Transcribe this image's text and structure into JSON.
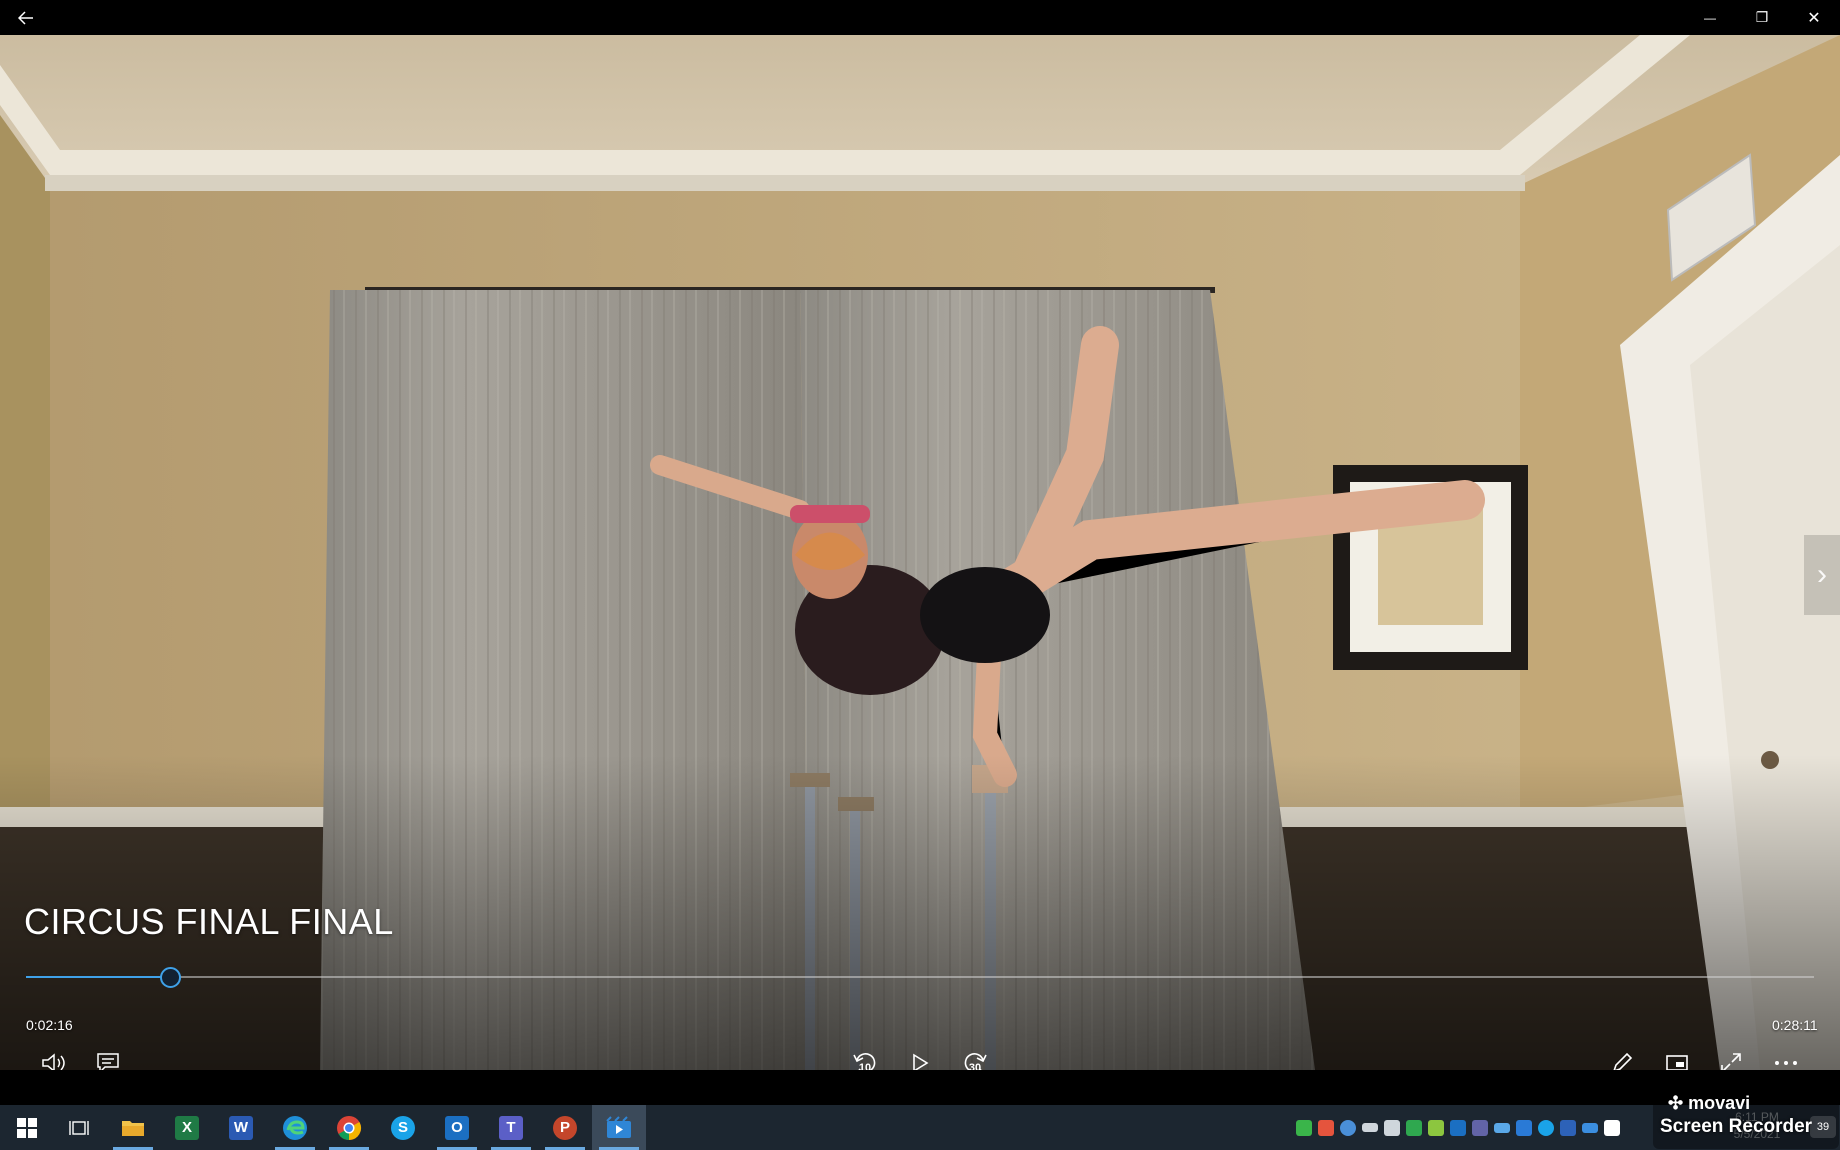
{
  "titlebar": {
    "back_icon": "back-arrow-icon",
    "minimize_glyph": "—",
    "restore_glyph": "❐",
    "close_glyph": "✕"
  },
  "video": {
    "title": "CIRCUS FINAL FINAL",
    "next_glyph": "›"
  },
  "playback": {
    "current_time": "0:02:16",
    "total_time": "0:28:11",
    "progress_fraction": 0.0806,
    "rewind_seconds": "10",
    "forward_seconds": "30"
  },
  "colors": {
    "accent": "#3fa1e8",
    "taskbar": "#1c2630"
  },
  "taskbar": {
    "apps": [
      {
        "name": "start-button",
        "icon": "windows-icon"
      },
      {
        "name": "task-view-button",
        "icon": "task-view-icon"
      },
      {
        "name": "file-explorer-button",
        "icon": "folder-icon"
      },
      {
        "name": "excel-button",
        "icon": "excel-icon",
        "letter": "X"
      },
      {
        "name": "word-button",
        "icon": "word-icon",
        "letter": "W"
      },
      {
        "name": "edge-button",
        "icon": "edge-icon"
      },
      {
        "name": "chrome-button",
        "icon": "chrome-icon"
      },
      {
        "name": "skype-button",
        "icon": "skype-icon",
        "letter": "S"
      },
      {
        "name": "outlook-button",
        "icon": "outlook-icon",
        "letter": "O"
      },
      {
        "name": "teams-button",
        "icon": "teams-icon",
        "letter": "T"
      },
      {
        "name": "powerpoint-button",
        "icon": "powerpoint-icon",
        "letter": "P"
      },
      {
        "name": "movies-tv-button",
        "icon": "movies-tv-icon"
      }
    ],
    "clock_time": "6:11 PM",
    "clock_date": "5/5/2021",
    "notification_count": "39"
  },
  "watermark": {
    "brand": "movavi",
    "product": "Screen Recorder"
  }
}
